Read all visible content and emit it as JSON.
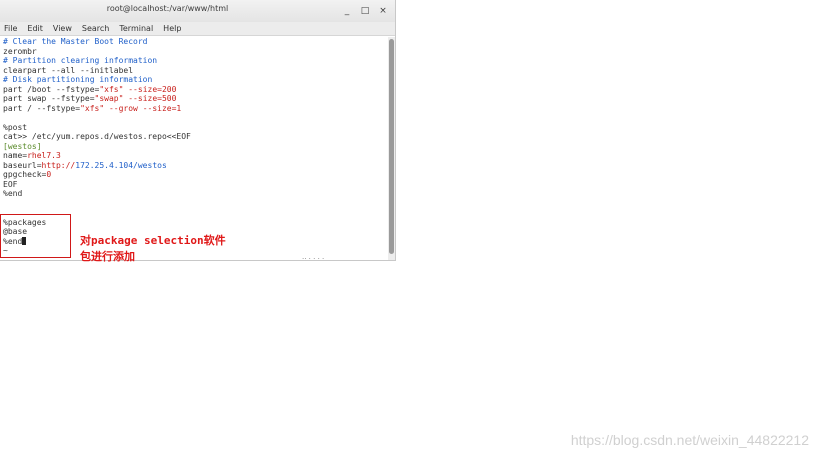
{
  "window": {
    "title": "root@localhost:/var/www/html",
    "minimize": "_",
    "maximize": "□",
    "close": "×"
  },
  "menu": [
    "File",
    "Edit",
    "View",
    "Search",
    "Terminal",
    "Help"
  ],
  "terminal_lines": [
    [
      {
        "t": "# Clear the Master Boot Record",
        "c": "comment"
      }
    ],
    [
      {
        "t": "zerombr",
        "c": "default"
      }
    ],
    [
      {
        "t": "# Partition clearing information",
        "c": "comment"
      }
    ],
    [
      {
        "t": "clearpart --all --initlabel",
        "c": "default"
      }
    ],
    [
      {
        "t": "# Disk partitioning information",
        "c": "comment"
      }
    ],
    [
      {
        "t": "part /boot --fstype=",
        "c": "default"
      },
      {
        "t": "\"xfs\"",
        "c": "red"
      },
      {
        "t": " --size=200",
        "c": "red"
      }
    ],
    [
      {
        "t": "part swap --fstype=",
        "c": "default"
      },
      {
        "t": "\"swap\"",
        "c": "red"
      },
      {
        "t": " --size=500",
        "c": "red"
      }
    ],
    [
      {
        "t": "part / --fstype=",
        "c": "default"
      },
      {
        "t": "\"xfs\"",
        "c": "red"
      },
      {
        "t": " --grow --size=1",
        "c": "red"
      }
    ],
    [
      {
        "t": "",
        "c": "default"
      }
    ],
    [
      {
        "t": "%post",
        "c": "default"
      }
    ],
    [
      {
        "t": "cat>> /etc/yum.repos.d/westos.repo<<EOF",
        "c": "default"
      }
    ],
    [
      {
        "t": "[westos]",
        "c": "section"
      }
    ],
    [
      {
        "t": "name=",
        "c": "default"
      },
      {
        "t": "rhel7.3",
        "c": "red"
      }
    ],
    [
      {
        "t": "baseurl=",
        "c": "default"
      },
      {
        "t": "http://",
        "c": "red"
      },
      {
        "t": "172.25.4.104/westos",
        "c": "comment"
      }
    ],
    [
      {
        "t": "gpgcheck=",
        "c": "default"
      },
      {
        "t": "0",
        "c": "red"
      }
    ],
    [
      {
        "t": "EOF",
        "c": "default"
      }
    ],
    [
      {
        "t": "%end",
        "c": "default"
      }
    ],
    [
      {
        "t": "",
        "c": "default"
      }
    ],
    [
      {
        "t": "",
        "c": "default"
      }
    ],
    [
      {
        "t": "%packages",
        "c": "default"
      }
    ],
    [
      {
        "t": "@base",
        "c": "default"
      }
    ],
    [
      {
        "t": "%end",
        "c": "default"
      },
      {
        "t": "",
        "c": "cursor"
      }
    ],
    [
      {
        "t": "~",
        "c": "default"
      }
    ]
  ],
  "annotation": "对package selection软件\n包进行添加",
  "watermark": "https://blog.csdn.net/weixin_44822212",
  "colors": {
    "comment": "#1f5fc9",
    "red": "#c8201c",
    "section": "#5a8a2a",
    "highlight_box": "#d01818",
    "annotation": "#e01818"
  }
}
